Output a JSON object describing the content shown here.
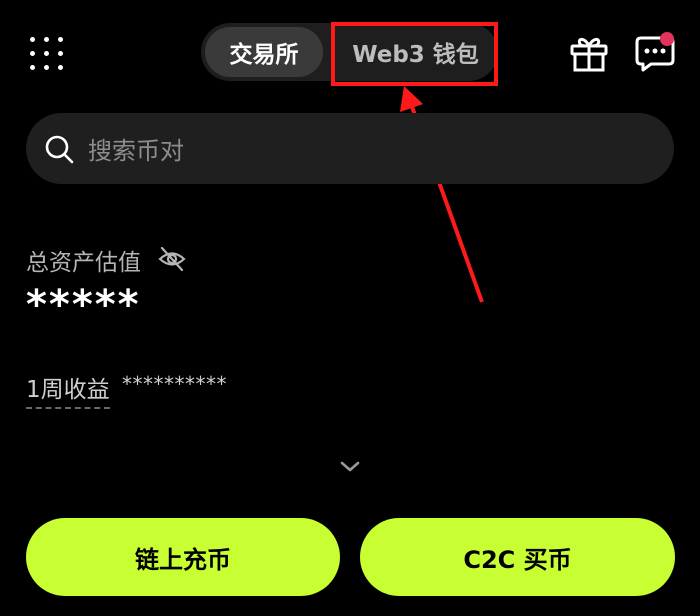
{
  "header": {
    "tab_exchange": "交易所",
    "tab_web3_wallet": "Web3 钱包"
  },
  "icons": {
    "menu": "grid-icon",
    "gift": "gift-icon",
    "chat": "chat-icon",
    "search": "search-icon",
    "visibility": "eye-off-icon",
    "expand": "chevron-down-icon"
  },
  "search": {
    "placeholder": "搜索币对"
  },
  "assets": {
    "total_label": "总资产估值",
    "total_value": "*****",
    "weekly_label": "1周收益",
    "weekly_value": "**********"
  },
  "actions": {
    "onchain_deposit": "链上充币",
    "c2c_buy": "C2C 买币"
  },
  "colors": {
    "background": "#000000",
    "accent": "#c8ff33",
    "annotation": "#ff1a1a",
    "badge": "#e0345a"
  }
}
